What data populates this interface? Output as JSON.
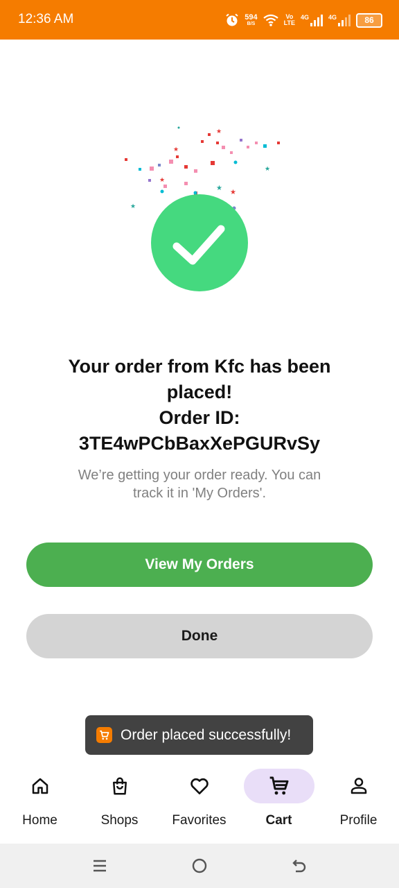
{
  "status_bar": {
    "time": "12:36 AM",
    "net_speed": "594",
    "net_unit": "B/S",
    "volte_top": "Vo",
    "volte_bottom": "LTE",
    "sim1": "4G",
    "sim2": "4G",
    "battery": "86",
    "icons": [
      "alarm-icon",
      "wifi-icon",
      "signal-icon",
      "battery-icon"
    ]
  },
  "success": {
    "icon": "check-circle-icon",
    "title_line1": "Your order from Kfc has been",
    "title_line2": "placed!",
    "title_line3": "Order ID:",
    "order_id": "3TE4wPCbBaxXePGURvSy",
    "subtitle_line1": "We’re getting your order ready. You can",
    "subtitle_line2": "track it in 'My Orders'."
  },
  "actions": {
    "view_orders": "View My Orders",
    "done": "Done"
  },
  "toast": {
    "icon": "cart-app-icon",
    "message": "Order placed successfully!"
  },
  "bottom_nav": {
    "items": [
      {
        "label": "Home",
        "icon": "home-icon"
      },
      {
        "label": "Shops",
        "icon": "shopping-bag-icon"
      },
      {
        "label": "Favorites",
        "icon": "heart-icon"
      },
      {
        "label": "Cart",
        "icon": "cart-icon",
        "active": true
      },
      {
        "label": "Profile",
        "icon": "profile-icon"
      }
    ]
  },
  "colors": {
    "status_bar": "#f57c00",
    "success_green": "#45d97f",
    "primary_button": "#4caf50",
    "secondary_button": "#d4d4d4",
    "active_nav_pill": "#e9def8"
  }
}
